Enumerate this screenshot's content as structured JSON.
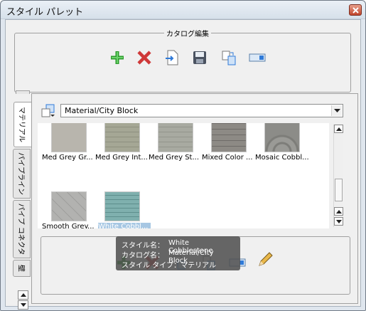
{
  "window": {
    "title": "スタイル パレット"
  },
  "catalog": {
    "label": "カタログ編集",
    "toolbar": [
      {
        "name": "add-icon",
        "color": "#2a9a2a"
      },
      {
        "name": "delete-icon",
        "color": "#d03a3a"
      },
      {
        "name": "import-icon",
        "color": "#2f7ad8"
      },
      {
        "name": "save-icon",
        "color": "#444b57"
      },
      {
        "name": "copy-icon",
        "color": "#2f7ad8"
      },
      {
        "name": "rename-icon",
        "color": "#2f7ad8"
      }
    ]
  },
  "tabs": [
    {
      "label": "マテリアル",
      "active": true
    },
    {
      "label": "パイプライン",
      "active": false
    },
    {
      "label": "パイプ コネクタ",
      "active": false
    },
    {
      "label": "壁"
    }
  ],
  "path": {
    "value": "Material/City Block"
  },
  "styles": [
    {
      "label": "Med Grey Gr...",
      "color": "#b8b5ad"
    },
    {
      "label": "Med Grey Int...",
      "color": "#a5a795"
    },
    {
      "label": "Med Grey St...",
      "color": "#a8aaa1"
    },
    {
      "label": "Mixed Color ...",
      "color": "#8d8a85"
    },
    {
      "label": "Mosaic Cobbl...",
      "color": "#8c8c88"
    },
    {
      "label": "Smooth Grey...",
      "color": "#b2b2b0"
    },
    {
      "label": "White Cobbl...",
      "color": "#78a8a6",
      "selected": true
    }
  ],
  "tooltip": {
    "rows": [
      {
        "key": "スタイル名：",
        "value": "White Cobblestone"
      },
      {
        "key": "カタログ名：",
        "value": "Material/City Block"
      },
      {
        "key": "スタイル タイプ：",
        "value": "マテリアル"
      }
    ]
  },
  "bottom_toolbar": [
    {
      "name": "add-icon"
    },
    {
      "name": "delete-icon"
    },
    {
      "name": "import-icon"
    },
    {
      "name": "copy-icon"
    },
    {
      "name": "rename-icon"
    },
    {
      "name": "edit-icon"
    }
  ]
}
